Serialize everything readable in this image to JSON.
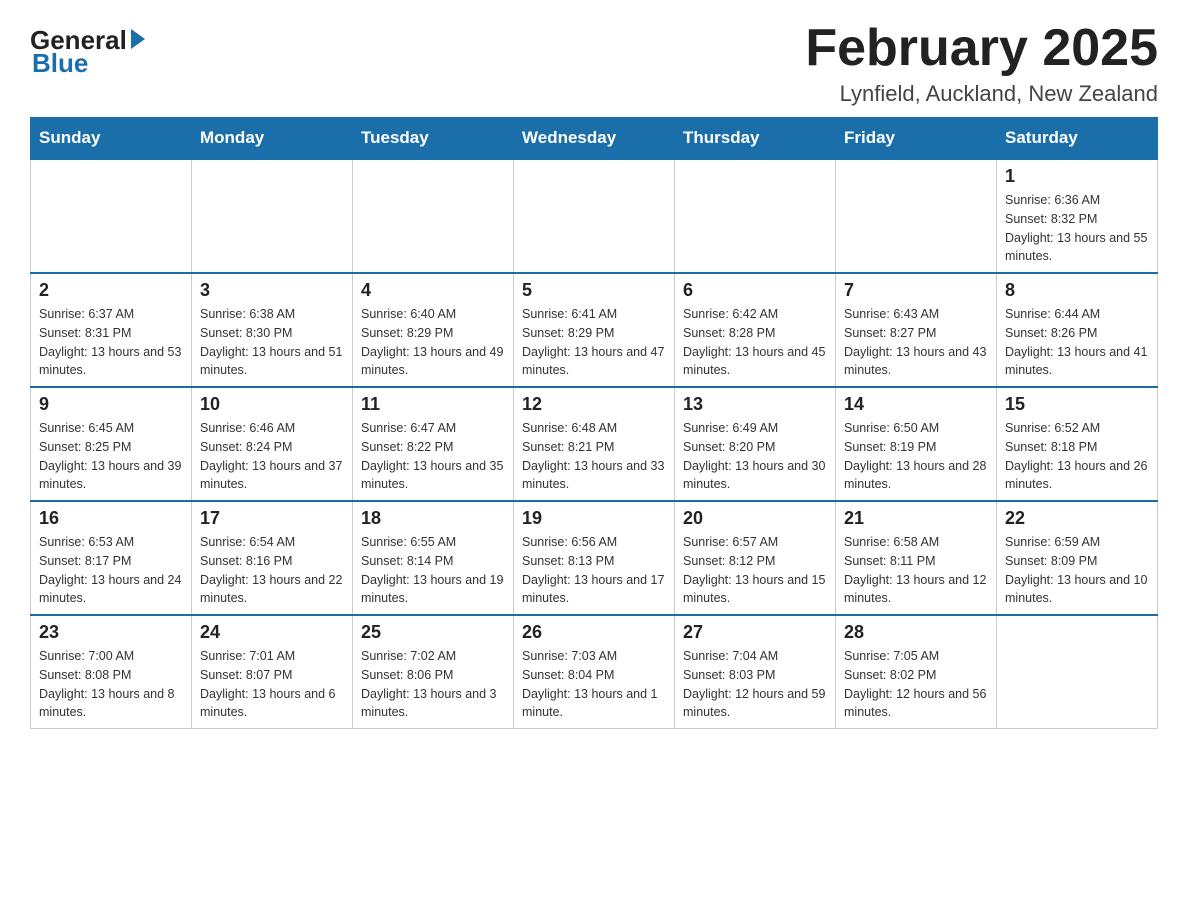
{
  "header": {
    "logo": {
      "general": "General",
      "blue": "Blue"
    },
    "title": "February 2025",
    "location": "Lynfield, Auckland, New Zealand"
  },
  "weekdays": [
    "Sunday",
    "Monday",
    "Tuesday",
    "Wednesday",
    "Thursday",
    "Friday",
    "Saturday"
  ],
  "weeks": [
    [
      {
        "day": "",
        "info": ""
      },
      {
        "day": "",
        "info": ""
      },
      {
        "day": "",
        "info": ""
      },
      {
        "day": "",
        "info": ""
      },
      {
        "day": "",
        "info": ""
      },
      {
        "day": "",
        "info": ""
      },
      {
        "day": "1",
        "info": "Sunrise: 6:36 AM\nSunset: 8:32 PM\nDaylight: 13 hours and 55 minutes."
      }
    ],
    [
      {
        "day": "2",
        "info": "Sunrise: 6:37 AM\nSunset: 8:31 PM\nDaylight: 13 hours and 53 minutes."
      },
      {
        "day": "3",
        "info": "Sunrise: 6:38 AM\nSunset: 8:30 PM\nDaylight: 13 hours and 51 minutes."
      },
      {
        "day": "4",
        "info": "Sunrise: 6:40 AM\nSunset: 8:29 PM\nDaylight: 13 hours and 49 minutes."
      },
      {
        "day": "5",
        "info": "Sunrise: 6:41 AM\nSunset: 8:29 PM\nDaylight: 13 hours and 47 minutes."
      },
      {
        "day": "6",
        "info": "Sunrise: 6:42 AM\nSunset: 8:28 PM\nDaylight: 13 hours and 45 minutes."
      },
      {
        "day": "7",
        "info": "Sunrise: 6:43 AM\nSunset: 8:27 PM\nDaylight: 13 hours and 43 minutes."
      },
      {
        "day": "8",
        "info": "Sunrise: 6:44 AM\nSunset: 8:26 PM\nDaylight: 13 hours and 41 minutes."
      }
    ],
    [
      {
        "day": "9",
        "info": "Sunrise: 6:45 AM\nSunset: 8:25 PM\nDaylight: 13 hours and 39 minutes."
      },
      {
        "day": "10",
        "info": "Sunrise: 6:46 AM\nSunset: 8:24 PM\nDaylight: 13 hours and 37 minutes."
      },
      {
        "day": "11",
        "info": "Sunrise: 6:47 AM\nSunset: 8:22 PM\nDaylight: 13 hours and 35 minutes."
      },
      {
        "day": "12",
        "info": "Sunrise: 6:48 AM\nSunset: 8:21 PM\nDaylight: 13 hours and 33 minutes."
      },
      {
        "day": "13",
        "info": "Sunrise: 6:49 AM\nSunset: 8:20 PM\nDaylight: 13 hours and 30 minutes."
      },
      {
        "day": "14",
        "info": "Sunrise: 6:50 AM\nSunset: 8:19 PM\nDaylight: 13 hours and 28 minutes."
      },
      {
        "day": "15",
        "info": "Sunrise: 6:52 AM\nSunset: 8:18 PM\nDaylight: 13 hours and 26 minutes."
      }
    ],
    [
      {
        "day": "16",
        "info": "Sunrise: 6:53 AM\nSunset: 8:17 PM\nDaylight: 13 hours and 24 minutes."
      },
      {
        "day": "17",
        "info": "Sunrise: 6:54 AM\nSunset: 8:16 PM\nDaylight: 13 hours and 22 minutes."
      },
      {
        "day": "18",
        "info": "Sunrise: 6:55 AM\nSunset: 8:14 PM\nDaylight: 13 hours and 19 minutes."
      },
      {
        "day": "19",
        "info": "Sunrise: 6:56 AM\nSunset: 8:13 PM\nDaylight: 13 hours and 17 minutes."
      },
      {
        "day": "20",
        "info": "Sunrise: 6:57 AM\nSunset: 8:12 PM\nDaylight: 13 hours and 15 minutes."
      },
      {
        "day": "21",
        "info": "Sunrise: 6:58 AM\nSunset: 8:11 PM\nDaylight: 13 hours and 12 minutes."
      },
      {
        "day": "22",
        "info": "Sunrise: 6:59 AM\nSunset: 8:09 PM\nDaylight: 13 hours and 10 minutes."
      }
    ],
    [
      {
        "day": "23",
        "info": "Sunrise: 7:00 AM\nSunset: 8:08 PM\nDaylight: 13 hours and 8 minutes."
      },
      {
        "day": "24",
        "info": "Sunrise: 7:01 AM\nSunset: 8:07 PM\nDaylight: 13 hours and 6 minutes."
      },
      {
        "day": "25",
        "info": "Sunrise: 7:02 AM\nSunset: 8:06 PM\nDaylight: 13 hours and 3 minutes."
      },
      {
        "day": "26",
        "info": "Sunrise: 7:03 AM\nSunset: 8:04 PM\nDaylight: 13 hours and 1 minute."
      },
      {
        "day": "27",
        "info": "Sunrise: 7:04 AM\nSunset: 8:03 PM\nDaylight: 12 hours and 59 minutes."
      },
      {
        "day": "28",
        "info": "Sunrise: 7:05 AM\nSunset: 8:02 PM\nDaylight: 12 hours and 56 minutes."
      },
      {
        "day": "",
        "info": ""
      }
    ]
  ]
}
